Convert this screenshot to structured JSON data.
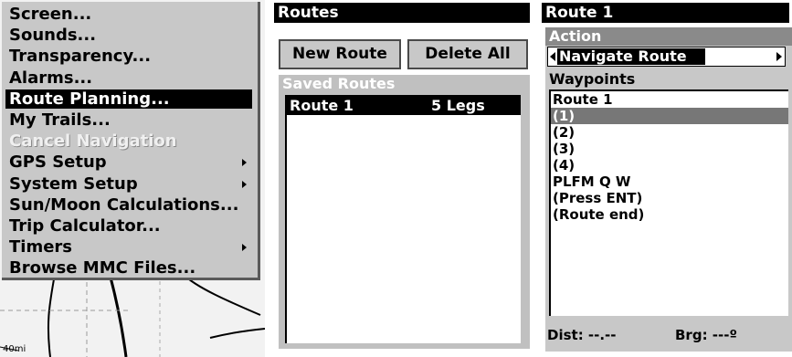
{
  "menu": {
    "items": [
      {
        "label": "Screen...",
        "state": "normal"
      },
      {
        "label": "Sounds...",
        "state": "normal"
      },
      {
        "label": "Transparency...",
        "state": "normal"
      },
      {
        "label": "Alarms...",
        "state": "normal"
      },
      {
        "label": "Route Planning...",
        "state": "selected"
      },
      {
        "label": "My Trails...",
        "state": "normal"
      },
      {
        "label": "Cancel Navigation",
        "state": "disabled"
      },
      {
        "label": "GPS Setup",
        "state": "normal",
        "submenu": true
      },
      {
        "label": "System Setup",
        "state": "normal",
        "submenu": true
      },
      {
        "label": "Sun/Moon Calculations...",
        "state": "normal"
      },
      {
        "label": "Trip Calculator...",
        "state": "normal"
      },
      {
        "label": "Timers",
        "state": "normal",
        "submenu": true
      },
      {
        "label": "Browse MMC Files...",
        "state": "normal"
      }
    ]
  },
  "map": {
    "scale_label": "40mi"
  },
  "routes": {
    "title": "Routes",
    "new_route_label": "New Route",
    "delete_all_label": "Delete All",
    "saved_header": "Saved Routes",
    "saved": [
      {
        "name": "Route 1",
        "legs": "5 Legs"
      }
    ]
  },
  "route_detail": {
    "title": "Route 1",
    "action_header": "Action",
    "action_value": "Navigate Route",
    "waypoints_header": "Waypoints",
    "waypoints": [
      "Route 1",
      "(1)",
      "(2)",
      "(3)",
      "(4)",
      "PLFM Q W",
      "(Press ENT)",
      "(Route end)"
    ],
    "selected_waypoint": "(1)",
    "dist_text": "Dist: --.--",
    "brg_text": "Brg: ---º"
  },
  "colors": {
    "selection": "#000000",
    "menu_bg": "#c8c8c8",
    "header_gray": "#8a8a8a",
    "selected_row_gray": "#777777"
  }
}
